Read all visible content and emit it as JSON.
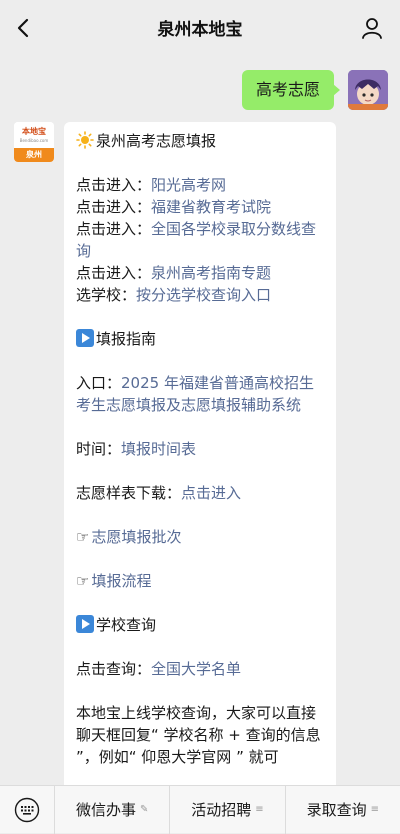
{
  "header": {
    "title": "泉州本地宝",
    "back_icon": "chevron-left-icon",
    "profile_icon": "person-icon"
  },
  "user_message": {
    "text": "高考志愿",
    "bubble_color": "#95ec69"
  },
  "bot": {
    "avatar_logo_text": "本地宝",
    "avatar_logo_sub": "Bendibao.com",
    "avatar_city": "泉州"
  },
  "message": {
    "heading": "泉州高考志愿填报",
    "links": [
      {
        "prefix": "点击进入：",
        "text": "阳光高考网"
      },
      {
        "prefix": "点击进入：",
        "text": "福建省教育考试院"
      },
      {
        "prefix": "点击进入：",
        "text": "全国各学校录取分数线查询"
      },
      {
        "prefix": "点击进入：",
        "text": "泉州高考指南专题"
      },
      {
        "prefix": "选学校：",
        "text": "按分选学校查询入口"
      }
    ],
    "section1_title": "填报指南",
    "entry_prefix": "入口：",
    "entry_link": "2025 年福建省普通高校招生考生志愿填报及志愿填报辅助系统",
    "time_prefix": "时间：",
    "time_link": "填报时间表",
    "download_prefix": "志愿样表下载：",
    "download_link": "点击进入",
    "batch_link": "志愿填报批次",
    "process_link": "填报流程",
    "section2_title": "学校查询",
    "query_prefix": "点击查询：",
    "query_link": "全国大学名单",
    "footer_text": "本地宝上线学校查询，大家可以直接聊天框回复“ 学校名称 + 查询的信息 ”，例如“ 仰恩大学官网 ” 就可",
    "link_color": "#576b95"
  },
  "bottom_menu": {
    "keyboard_icon": "keyboard-icon",
    "items": [
      {
        "label": "微信办事",
        "icon": "pencil-icon"
      },
      {
        "label": "活动招聘",
        "icon": "menu-lines-icon"
      },
      {
        "label": "录取查询",
        "icon": "menu-lines-icon"
      }
    ]
  }
}
